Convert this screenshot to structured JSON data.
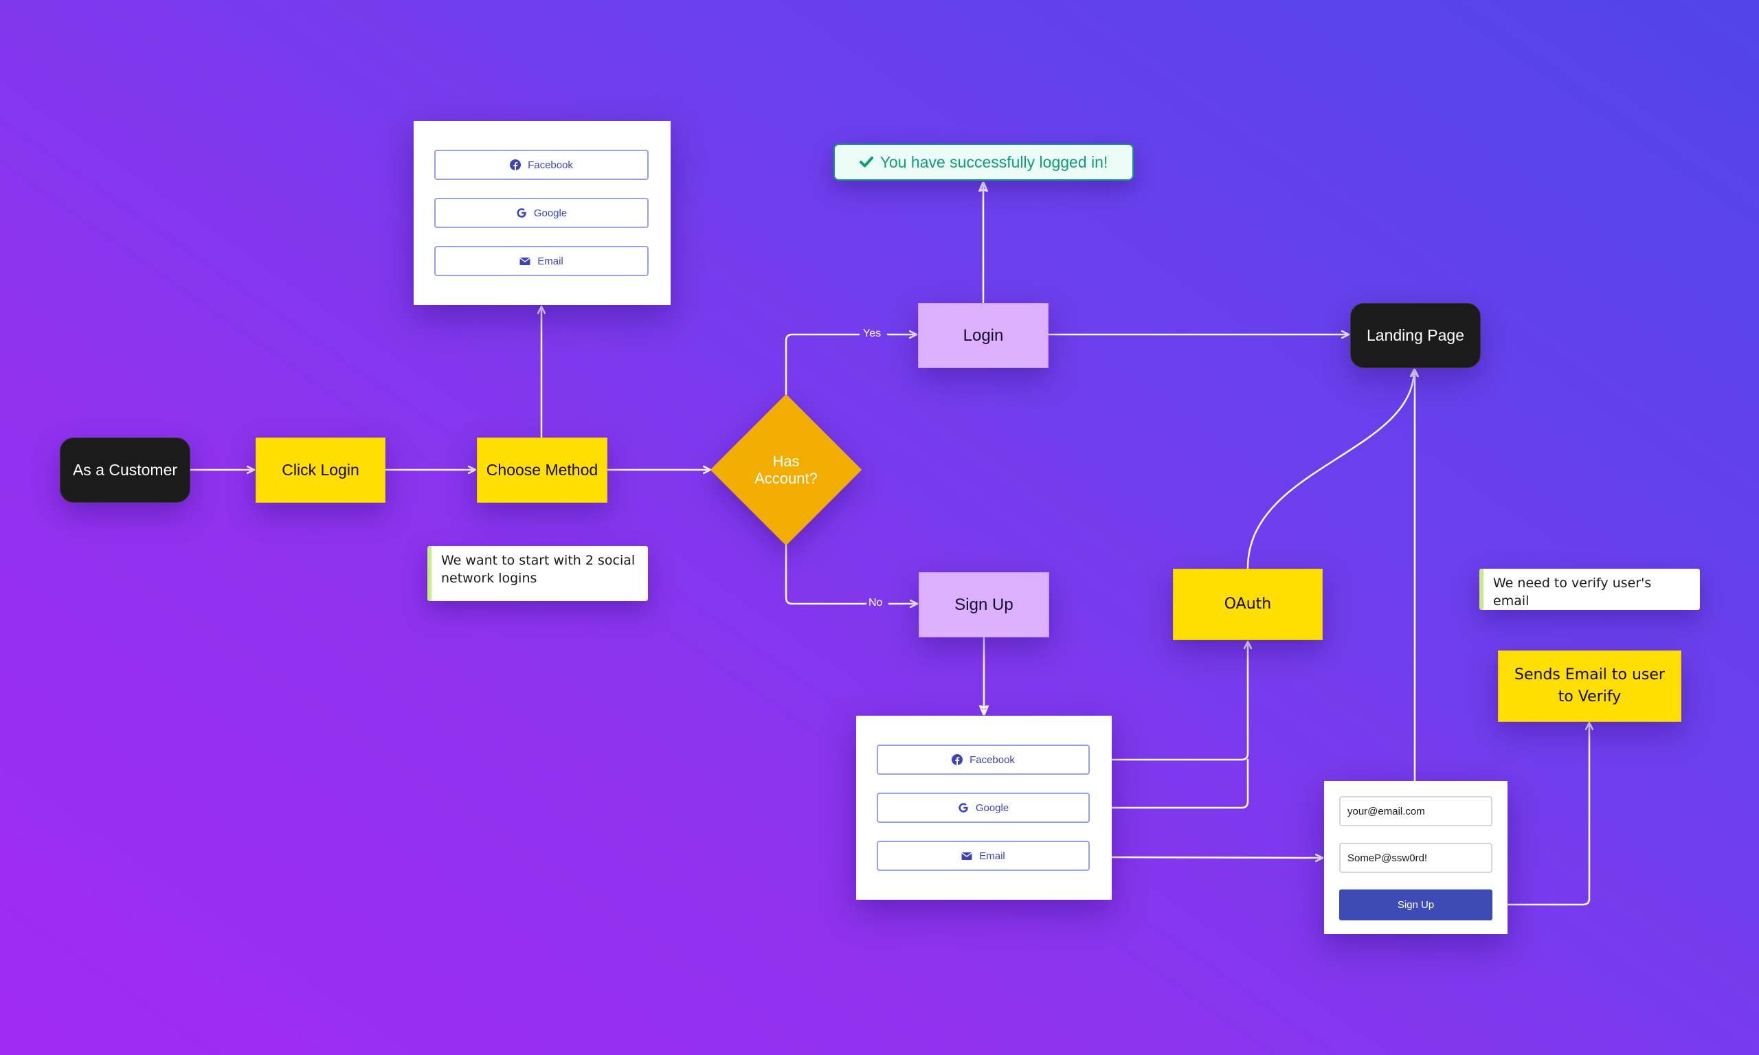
{
  "colors": {
    "background_start": "#a12bf2",
    "background_end": "#5145e8",
    "terminal_node": "#1b1b1b",
    "process_node": "#ffde00",
    "state_node": "#ddb0fd",
    "decision_node": "#f2ae00",
    "button_accent": "#3e4bb7",
    "success": "#0f9d76",
    "note_accent": "#c4ee82"
  },
  "nodes": {
    "start": "As a Customer",
    "click_login": "Click Login",
    "choose_method": "Choose Method",
    "decision": "Has Account?",
    "login": "Login",
    "sign_up": "Sign Up",
    "landing_page": "Landing Page",
    "oauth": "OAuth",
    "send_email": "Sends Email to user to Verify"
  },
  "edge_labels": {
    "yes": "Yes",
    "no": "No"
  },
  "login_options_card": {
    "options": [
      {
        "label": "Facebook",
        "icon": "facebook-icon"
      },
      {
        "label": "Google",
        "icon": "google-icon"
      },
      {
        "label": "Email",
        "icon": "envelope-icon"
      }
    ]
  },
  "signup_options_card": {
    "options": [
      {
        "label": "Facebook",
        "icon": "facebook-icon"
      },
      {
        "label": "Google",
        "icon": "google-icon"
      },
      {
        "label": "Email",
        "icon": "envelope-icon"
      }
    ]
  },
  "success_message": {
    "icon": "check-icon",
    "text": "You have successfully logged in!"
  },
  "notes": {
    "social_logins": "We want to start with 2 social network logins",
    "verify_email": "We need to verify user's email"
  },
  "signup_form": {
    "email_value": "your@email.com",
    "password_value": "SomeP@ssw0rd!",
    "submit_label": "Sign Up"
  }
}
